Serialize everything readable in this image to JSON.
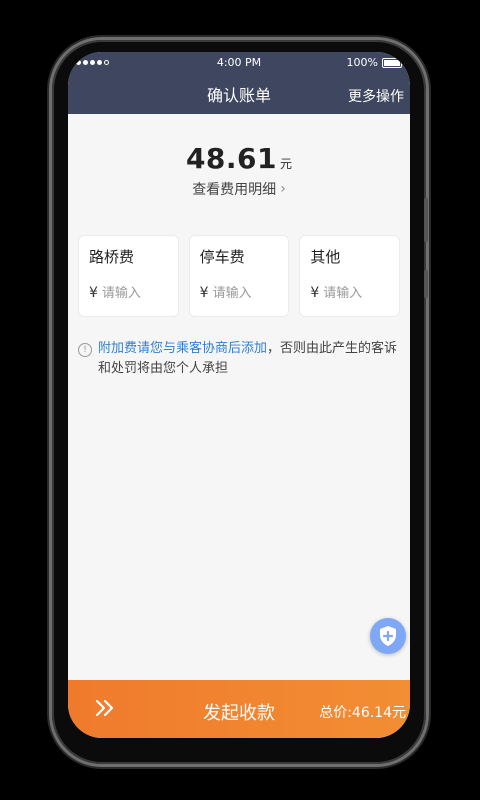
{
  "status_bar": {
    "time": "4:00 PM",
    "battery": "100%"
  },
  "navbar": {
    "title": "确认账单",
    "more": "更多操作"
  },
  "amount": {
    "value": "48.61",
    "unit": "元",
    "detail_link": "查看费用明细"
  },
  "fees": [
    {
      "label": "路桥费",
      "currency": "¥",
      "placeholder": "请输入"
    },
    {
      "label": "停车费",
      "currency": "¥",
      "placeholder": "请输入"
    },
    {
      "label": "其他",
      "currency": "¥",
      "placeholder": "请输入"
    }
  ],
  "notice": {
    "highlight": "附加费请您与乘客协商后添加",
    "rest": "，否则由此产生的客诉和处罚将由您个人承担"
  },
  "bottom": {
    "pay_button": "发起收款",
    "total": "总价:46.14元"
  },
  "colors": {
    "header": "#3f4760",
    "accent_orange": "#f07a2c",
    "link_blue": "#2f7fd6",
    "fab_blue": "#7ea8f5"
  },
  "icons": {
    "info": "info-circle-icon",
    "detail": "chevron-right-icon",
    "fab": "shield-plus-icon",
    "swipe": "double-chevron-right-icon"
  }
}
